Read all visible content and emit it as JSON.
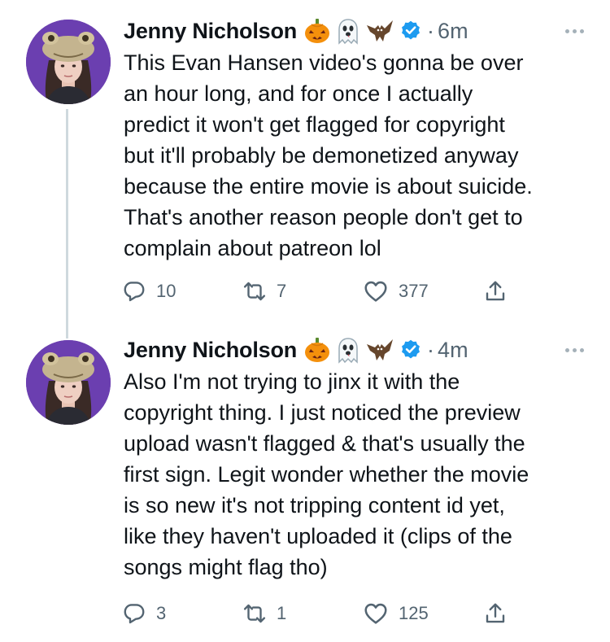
{
  "tweets": [
    {
      "author": "Jenny Nicholson",
      "time": "6m",
      "separator": "·",
      "text": "This Evan Hansen video's gonna be over\nan hour long, and for once I actually\npredict it won't get flagged for copyright\nbut it'll probably be demonetized anyway\nbecause the entire movie is about suicide.\nThat's another reason people don't get to\ncomplain about patreon lol",
      "replies": "10",
      "retweets": "7",
      "likes": "377"
    },
    {
      "author": "Jenny Nicholson",
      "time": "4m",
      "separator": "·",
      "text": "Also I'm not trying to jinx it with the\ncopyright thing. I just noticed the preview\nupload wasn't flagged & that's usually the\nfirst sign. Legit wonder whether the movie\nis so new it's not tripping content id yet,\nlike they haven't uploaded it (clips of the\nsongs might flag tho)",
      "replies": "3",
      "retweets": "1",
      "likes": "125"
    }
  ],
  "name_emojis": [
    "jack-o-lantern-icon",
    "ghost-icon",
    "bat-icon"
  ],
  "icons": {
    "reply": "reply-icon",
    "retweet": "retweet-icon",
    "like": "heart-icon",
    "share": "share-icon",
    "verified": "verified-badge-icon",
    "more": "more-options-icon"
  },
  "colors": {
    "text": "#0f1419",
    "secondary": "#536471",
    "verified": "#1d9bf0",
    "thread_line": "#cfd9de",
    "avatar_bg": "#6b3fb0"
  }
}
